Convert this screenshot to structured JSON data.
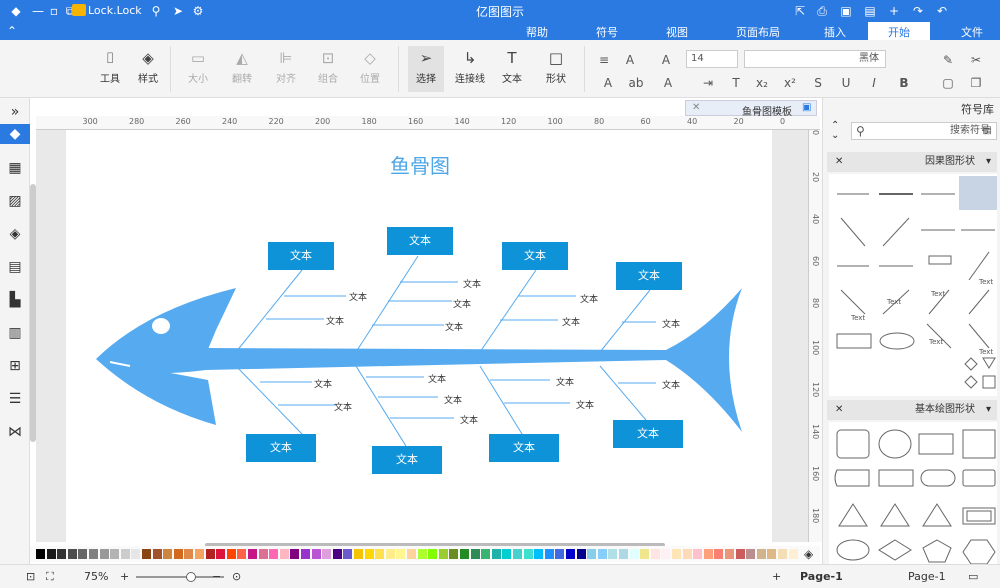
{
  "app": {
    "title": "亿图图示",
    "user": "Lock.Lock"
  },
  "menu": {
    "items": [
      "文件",
      "开始",
      "插入",
      "页面布局",
      "视图",
      "符号",
      "帮助"
    ]
  },
  "ribbon": {
    "tools": {
      "tool": "工具",
      "style": "样式",
      "size": "大小",
      "flip": "翻转",
      "align": "对齐",
      "group": "组合",
      "position": "位置",
      "select": "选择",
      "connector": "连接线",
      "text": "文本",
      "shape": "形状"
    },
    "font_name": "黑体",
    "font_size": "14"
  },
  "left_toolbar": {
    "icons": [
      "fill-icon",
      "layout-icon",
      "image-icon",
      "layers-icon",
      "page-icon",
      "chart-icon",
      "table-icon",
      "org-icon",
      "list-icon",
      "mindmap-icon"
    ]
  },
  "document": {
    "tab_name": "鱼骨图模板"
  },
  "ruler": {
    "h_ticks": [
      "0",
      "20",
      "40",
      "60",
      "80",
      "100",
      "120",
      "140",
      "160",
      "180",
      "200",
      "220",
      "240",
      "260",
      "280",
      "300"
    ],
    "v_ticks": [
      "0",
      "20",
      "40",
      "60",
      "80",
      "100",
      "120",
      "140",
      "160",
      "180"
    ]
  },
  "diagram": {
    "title": "鱼骨图",
    "box_text": "文本",
    "label_text": "文本",
    "fish_color": "#55aaf0",
    "box_color": "#0e93d8"
  },
  "palette": {
    "colors": [
      "#000000",
      "#1a1a1a",
      "#333333",
      "#4d4d4d",
      "#666666",
      "#808080",
      "#999999",
      "#b3b3b3",
      "#cccccc",
      "#e6e6e6",
      "#8b4513",
      "#a0522d",
      "#cd853f",
      "#d2691e",
      "#e08a4a",
      "#f4a460",
      "#b22222",
      "#dc143c",
      "#ff4500",
      "#ff6347",
      "#c71585",
      "#db7093",
      "#ff69b4",
      "#ffb6c1",
      "#800080",
      "#9932cc",
      "#ba55d3",
      "#dda0dd",
      "#4b0082",
      "#6a5acd",
      "#f5c400",
      "#ffd700",
      "#ffe14d",
      "#ffec8b",
      "#fff68f",
      "#ffd39b",
      "#adff2f",
      "#7fff00",
      "#9acd32",
      "#6b8e23",
      "#228b22",
      "#2e8b57",
      "#3cb371",
      "#20b2aa",
      "#00ced1",
      "#48d1cc",
      "#40e0d0",
      "#00bfff",
      "#1e90ff",
      "#4169e1",
      "#0000cd",
      "#00008b",
      "#87ceeb",
      "#87cefa",
      "#b0e0e6",
      "#add8e6",
      "#e0ffff",
      "#f0e68c",
      "#ffe4e1",
      "#fff0f5",
      "#ffe4b5",
      "#ffdab9",
      "#ffc0cb",
      "#ffa07a",
      "#fa8072",
      "#e9967a",
      "#cd5c5c",
      "#bc8f8f",
      "#d2b48c",
      "#deb887",
      "#f5deb3",
      "#ffefd5"
    ]
  },
  "statusbar": {
    "page_selector": "Page-1",
    "page_tab": "Page-1",
    "zoom": "75%"
  },
  "right_panel": {
    "title": "符号库",
    "search_placeholder": "搜索符号",
    "section1": "因果图形状",
    "section2": "基本绘图形状",
    "text_label": "Text"
  }
}
